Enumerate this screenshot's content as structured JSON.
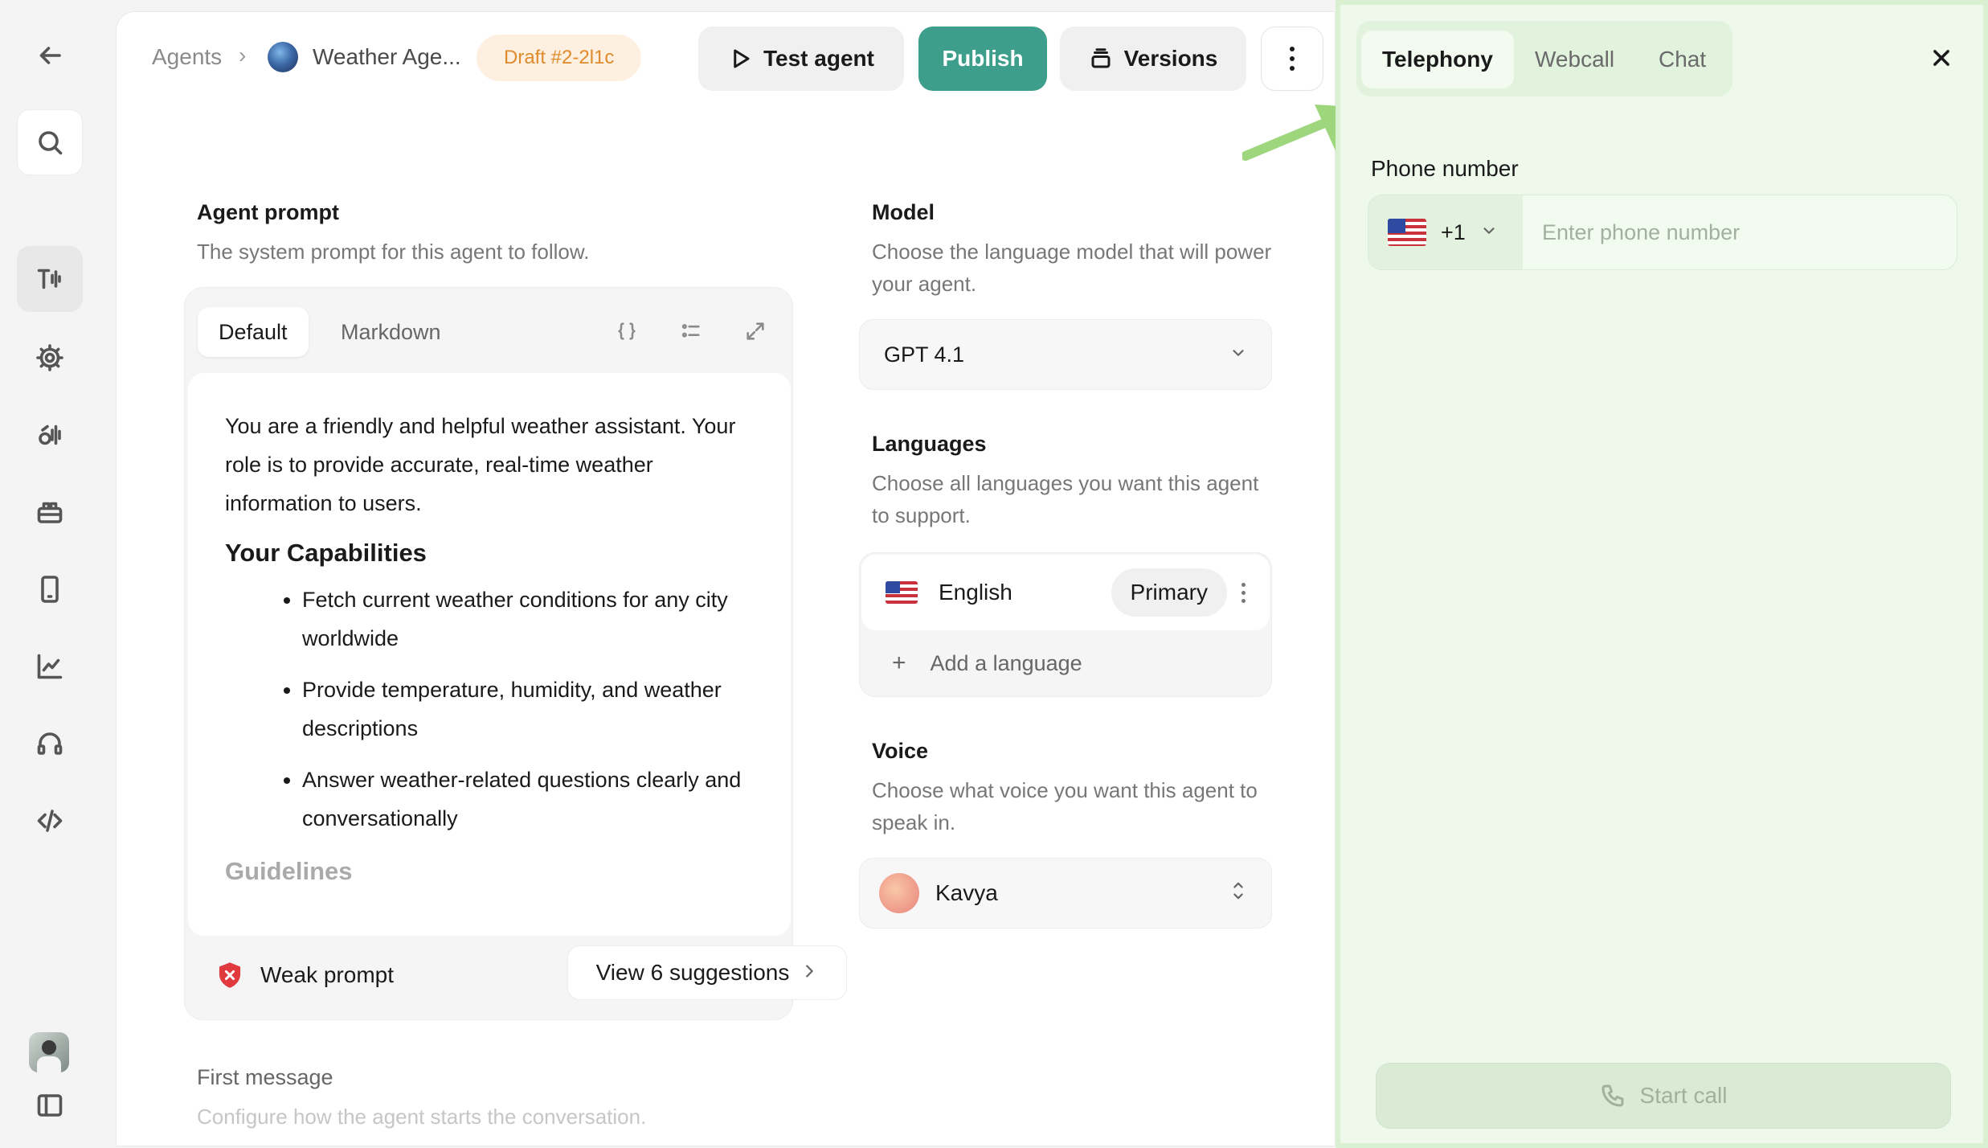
{
  "breadcrumb": {
    "root": "Agents",
    "separator": "›",
    "current": "Weather Age..."
  },
  "draft_badge": "Draft #2-2l1c",
  "toolbar": {
    "test_label": "Test agent",
    "publish_label": "Publish",
    "versions_label": "Versions"
  },
  "prompt": {
    "title": "Agent prompt",
    "description": "The system prompt for this agent to follow.",
    "tabs": [
      "Default",
      "Markdown"
    ],
    "intro": "You are a friendly and helpful weather assistant. Your role is to provide accurate, real-time weather information to users.",
    "capabilities_heading": "Your Capabilities",
    "capabilities": [
      "Fetch current weather conditions for any city worldwide",
      "Provide temperature, humidity, and weather descriptions",
      "Answer weather-related questions clearly and conversationally"
    ],
    "guidelines_heading": "Guidelines",
    "strength_label": "Weak prompt",
    "suggestions_label": "View 6 suggestions"
  },
  "first_message": {
    "title": "First message",
    "description": "Configure how the agent starts the conversation."
  },
  "model": {
    "title": "Model",
    "description": "Choose the language model that will power your agent.",
    "selected": "GPT 4.1"
  },
  "languages": {
    "title": "Languages",
    "description": "Choose all languages you want this agent to support.",
    "items": [
      {
        "name": "English",
        "badge": "Primary"
      }
    ],
    "add_label": "Add a language"
  },
  "voice": {
    "title": "Voice",
    "description": "Choose what voice you want this agent to speak in.",
    "selected": "Kavya"
  },
  "test_panel": {
    "tabs": [
      "Telephony",
      "Webcall",
      "Chat"
    ],
    "active_tab": "Telephony",
    "phone_label": "Phone number",
    "country_code": "+1",
    "phone_placeholder": "Enter phone number",
    "start_call_label": "Start call"
  },
  "colors": {
    "accent": "#3d9e8c",
    "draft_text": "#e08a2c",
    "panel_bg": "#eef9ec",
    "warning": "#e0393e"
  }
}
